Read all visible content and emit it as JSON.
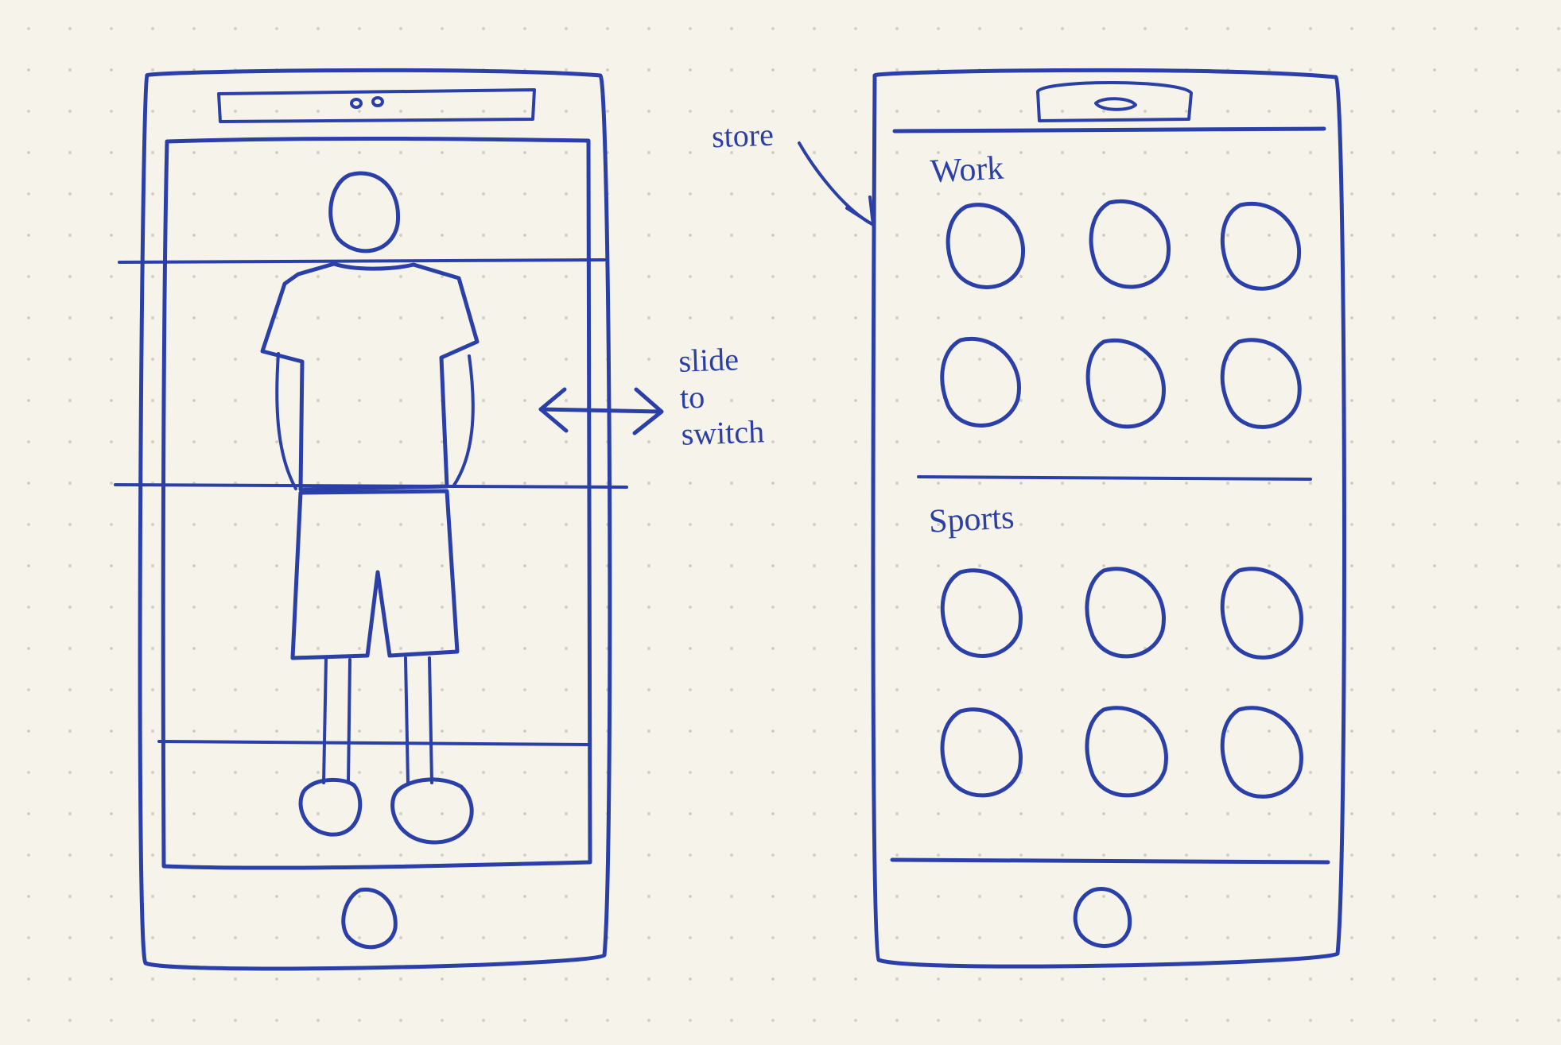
{
  "annotations": {
    "slide": "slide\nto\nswitch",
    "store": "store"
  },
  "store_screen": {
    "category_1": {
      "label": "Work",
      "item_count": 6
    },
    "category_2": {
      "label": "Sports",
      "item_count": 6
    }
  },
  "avatar_screen": {
    "zones": [
      "head",
      "torso",
      "legs",
      "feet"
    ]
  },
  "ink_color": "#2b3fa8"
}
